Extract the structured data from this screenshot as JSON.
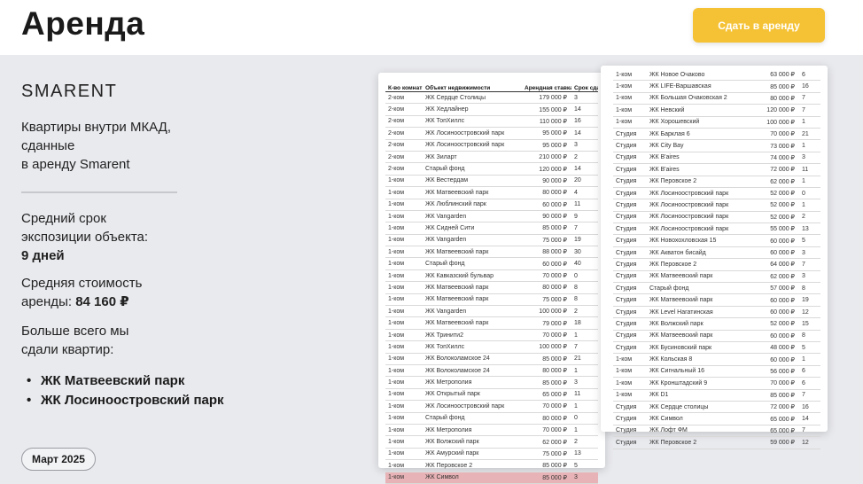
{
  "header": {
    "title": "Аренда",
    "cta_label": "Сдать в аренду"
  },
  "colors": {
    "accent": "#f5c235",
    "highlight_row": "#e8b3b6"
  },
  "summary": {
    "brand": "SMARENT",
    "subtitle_lines": [
      "Квартиры внутри МКАД,",
      "сданные",
      "в аренду Smarent"
    ],
    "avg_exposure_label_1": "Средний срок",
    "avg_exposure_label_2": "экспозиции объекта:",
    "avg_exposure_value": "9 дней",
    "avg_price_label_1": "Средняя стоимость",
    "avg_price_label_2": "аренды:",
    "avg_price_value": "84 160 ₽",
    "top_label_1": "Больше всего мы",
    "top_label_2": "сдали квартир:",
    "top_complexes": [
      "ЖК Матвеевский парк",
      "ЖК Лосиноостровский парк"
    ],
    "date": "Март 2025"
  },
  "table": {
    "headers": [
      "К-во комнат",
      "Объект недвижимости",
      "Арендная ставка, ₽",
      "Срок сдачи"
    ],
    "highlighted_row": 33,
    "rows_left": [
      [
        "2-ком",
        "ЖК Сердце Столицы",
        "179 000 ₽",
        "3"
      ],
      [
        "2-ком",
        "ЖК Хедлайнер",
        "155 000 ₽",
        "14"
      ],
      [
        "2-ком",
        "ЖК ТопХиллс",
        "110 000 ₽",
        "16"
      ],
      [
        "2-ком",
        "ЖК Лосиноостровский парк",
        "95 000 ₽",
        "14"
      ],
      [
        "2-ком",
        "ЖК Лосиноостровский парк",
        "95 000 ₽",
        "3"
      ],
      [
        "2-ком",
        "ЖК Зиларт",
        "210 000 ₽",
        "2"
      ],
      [
        "2-ком",
        "Старый фонд",
        "120 000 ₽",
        "14"
      ],
      [
        "1-ком",
        "ЖК Вестердам",
        "90 000 ₽",
        "20"
      ],
      [
        "1-ком",
        "ЖК Матвеевский парк",
        "80 000 ₽",
        "4"
      ],
      [
        "1-ком",
        "ЖК Люблинский парк",
        "60 000 ₽",
        "11"
      ],
      [
        "1-ком",
        "ЖК Vangarden",
        "90 000 ₽",
        "9"
      ],
      [
        "1-ком",
        "ЖК Сидней Сити",
        "85 000 ₽",
        "7"
      ],
      [
        "1-ком",
        "ЖК Vangarden",
        "75 000 ₽",
        "19"
      ],
      [
        "1-ком",
        "ЖК Матвеевский парк",
        "88 000 ₽",
        "30"
      ],
      [
        "1-ком",
        "Старый фонд",
        "60 000 ₽",
        "40"
      ],
      [
        "1-ком",
        "ЖК Кавказский бульвар",
        "70 000 ₽",
        "0"
      ],
      [
        "1-ком",
        "ЖК Матвеевский парк",
        "80 000 ₽",
        "8"
      ],
      [
        "1-ком",
        "ЖК Матвеевский парк",
        "75 000 ₽",
        "8"
      ],
      [
        "1-ком",
        "ЖК Vangarden",
        "100 000 ₽",
        "2"
      ],
      [
        "1-ком",
        "ЖК Матвеевский парк",
        "79 000 ₽",
        "18"
      ],
      [
        "1-ком",
        "ЖК Тринити2",
        "70 000 ₽",
        "1"
      ],
      [
        "1-ком",
        "ЖК ТопХиллс",
        "100 000 ₽",
        "7"
      ],
      [
        "1-ком",
        "ЖК Волоколамское 24",
        "85 000 ₽",
        "21"
      ],
      [
        "1-ком",
        "ЖК Волоколамское 24",
        "80 000 ₽",
        "1"
      ],
      [
        "1-ком",
        "ЖК Метрополия",
        "85 000 ₽",
        "3"
      ],
      [
        "1-ком",
        "ЖК Открытый парк",
        "65 000 ₽",
        "11"
      ],
      [
        "1-ком",
        "ЖК Лосиноостровский парк",
        "70 000 ₽",
        "1"
      ],
      [
        "1-ком",
        "Старый фонд",
        "80 000 ₽",
        "0"
      ],
      [
        "1-ком",
        "ЖК Метрополия",
        "70 000 ₽",
        "1"
      ],
      [
        "1-ком",
        "ЖК Волжский парк",
        "62 000 ₽",
        "2"
      ],
      [
        "1-ком",
        "ЖК Амурский парк",
        "75 000 ₽",
        "13"
      ],
      [
        "1-ком",
        "ЖК Перовское 2",
        "85 000 ₽",
        "5"
      ],
      [
        "1-ком",
        "ЖК Символ",
        "85 000 ₽",
        "3"
      ]
    ],
    "rows_right": [
      [
        "1-ком",
        "ЖК Новое Очаково",
        "63 000 ₽",
        "6"
      ],
      [
        "1-ком",
        "ЖК LIFE-Варшавская",
        "85 000 ₽",
        "16"
      ],
      [
        "1-ком",
        "ЖК Большая Очаковская 2",
        "80 000 ₽",
        "7"
      ],
      [
        "1-ком",
        "ЖК Невский",
        "120 000 ₽",
        "7"
      ],
      [
        "1-ком",
        "ЖК Хорошевский",
        "100 000 ₽",
        "1"
      ],
      [
        "Студия",
        "ЖК Барклая 6",
        "70 000 ₽",
        "21"
      ],
      [
        "Студия",
        "ЖК City Bay",
        "73 000 ₽",
        "1"
      ],
      [
        "Студия",
        "ЖК B'aires",
        "74 000 ₽",
        "3"
      ],
      [
        "Студия",
        "ЖК B'aires",
        "72 000 ₽",
        "11"
      ],
      [
        "Студия",
        "ЖК Перовское 2",
        "62 000 ₽",
        "1"
      ],
      [
        "Студия",
        "ЖК Лосиноостровский парк",
        "52 000 ₽",
        "0"
      ],
      [
        "Студия",
        "ЖК Лосиноостровский парк",
        "52 000 ₽",
        "1"
      ],
      [
        "Студия",
        "ЖК Лосиноостровский парк",
        "52 000 ₽",
        "2"
      ],
      [
        "Студия",
        "ЖК Лосиноостровский парк",
        "55 000 ₽",
        "13"
      ],
      [
        "Студия",
        "ЖК Новохохловская 15",
        "60 000 ₽",
        "5"
      ],
      [
        "Студия",
        "ЖК Акватон бисайд",
        "60 000 ₽",
        "3"
      ],
      [
        "Студия",
        "ЖК Перовское 2",
        "64 000 ₽",
        "7"
      ],
      [
        "Студия",
        "ЖК Матвеевский парк",
        "62 000 ₽",
        "3"
      ],
      [
        "Студия",
        "Старый фонд",
        "57 000 ₽",
        "8"
      ],
      [
        "Студия",
        "ЖК Матвеевский парк",
        "60 000 ₽",
        "19"
      ],
      [
        "Студия",
        "ЖК Level Нагатинская",
        "60 000 ₽",
        "12"
      ],
      [
        "Студия",
        "ЖК Волжский парк",
        "52 000 ₽",
        "15"
      ],
      [
        "Студия",
        "ЖК Матвеевский парк",
        "60 000 ₽",
        "8"
      ],
      [
        "Студия",
        "ЖК Бусиновский парк",
        "48 000 ₽",
        "5"
      ],
      [
        "1-ком",
        "ЖК Кольская 8",
        "60 000 ₽",
        "1"
      ],
      [
        "1-ком",
        "ЖК Сигнальный 16",
        "56 000 ₽",
        "6"
      ],
      [
        "1-ком",
        "ЖК Кронштадский 9",
        "70 000 ₽",
        "6"
      ],
      [
        "1-ком",
        "ЖК D1",
        "85 000 ₽",
        "7"
      ],
      [
        "Студия",
        "ЖК Сердце столицы",
        "72 000 ₽",
        "16"
      ],
      [
        "Студия",
        "ЖК Символ",
        "65 000 ₽",
        "14"
      ],
      [
        "Студия",
        "ЖК Лофт ФМ",
        "65 000 ₽",
        "7"
      ],
      [
        "Студия",
        "ЖК Перовское 2",
        "59 000 ₽",
        "12"
      ]
    ]
  }
}
